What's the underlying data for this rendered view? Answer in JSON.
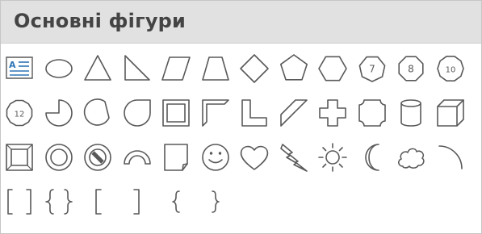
{
  "section": {
    "title": "Основні фігури"
  },
  "shapes": {
    "rows": [
      [
        "text-box",
        "oval",
        "isosceles-triangle",
        "right-triangle",
        "parallelogram",
        "trapezoid",
        "diamond",
        "pentagon",
        "hexagon",
        "heptagon",
        "octagon",
        "decagon"
      ],
      [
        "dodecagon",
        "pie",
        "chord",
        "teardrop",
        "frame",
        "half-frame",
        "l-shape",
        "diagonal-stripe",
        "cross",
        "plaque",
        "can",
        "cube"
      ],
      [
        "bevel",
        "donut",
        "no-symbol",
        "block-arc",
        "folded-corner",
        "smiley-face",
        "heart",
        "lightning-bolt",
        "sun",
        "moon",
        "cloud",
        "arc"
      ],
      [
        "double-bracket",
        "double-brace",
        "left-bracket",
        "right-bracket",
        "left-brace",
        "right-brace"
      ]
    ],
    "labels": {
      "heptagon": "7",
      "octagon": "8",
      "decagon": "10",
      "dodecagon": "12"
    }
  }
}
